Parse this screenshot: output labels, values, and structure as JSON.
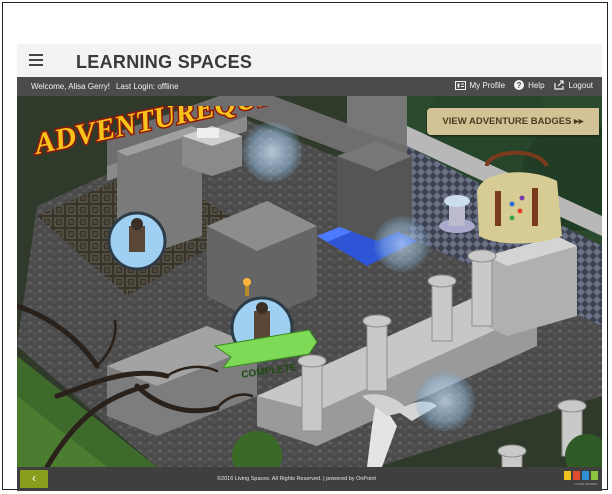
{
  "header": {
    "brand": "LEARNING SPACES"
  },
  "subbar": {
    "welcome": "Welcome, Alisa Gerry!",
    "last_login": "Last Login: offline",
    "nav": [
      {
        "label": "My Profile",
        "icon": "profile-icon"
      },
      {
        "label": "Help",
        "icon": "help-icon"
      },
      {
        "label": "Logout",
        "icon": "logout-icon"
      }
    ]
  },
  "scene": {
    "title": "ADVENTUREQUEST",
    "badge_button": "VIEW ADVENTURE BADGES ▸▸",
    "complete_label": "COMPLETE"
  },
  "footer": {
    "back_icon": "‹",
    "copyright": "©2016 Living Spaces. All Rights Reserved. | powered by OnPoint",
    "logo_text": "LIVING SPACES"
  },
  "colors": {
    "header_bg": "#f3f3f3",
    "subbar_bg": "#4b4b4b",
    "footer_bg": "#3f3f3f",
    "back_button": "#8b9d1d",
    "badge_button": "#d2c397",
    "complete_ribbon": "#7ed957"
  }
}
